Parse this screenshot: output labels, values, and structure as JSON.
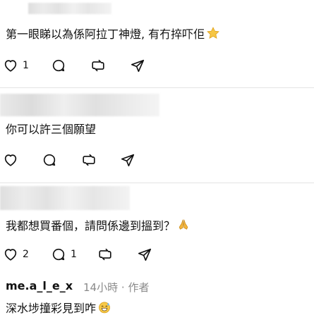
{
  "comments": [
    {
      "text": "第一眼睇以為係阿拉丁神燈, 有冇捽吓佢",
      "emoji_icon": "star-emoji",
      "like_count": "1",
      "reply_count": ""
    },
    {
      "text": "你可以許三個願望",
      "like_count": "",
      "reply_count": ""
    },
    {
      "text": "我都想買番個，請問係邊到搵到？",
      "emoji_icon": "folded-hands-emoji",
      "like_count": "2",
      "reply_count": "1"
    },
    {
      "username": "me.a_l_e_x",
      "time": "14小時",
      "separator": "·",
      "author_label": "作者",
      "text": "深水埗撞彩見到咋",
      "emoji_icon": "grinning-sweat-emoji"
    }
  ],
  "icons": {
    "like": "heart-icon",
    "reply": "speech-bubble-icon",
    "repost": "repost-icon",
    "share": "send-icon"
  },
  "colors": {
    "text": "#111111",
    "muted": "#8a8a8a",
    "divider": "#e4e4e4",
    "star": "#f6c644",
    "hands": "#f3b53c"
  }
}
